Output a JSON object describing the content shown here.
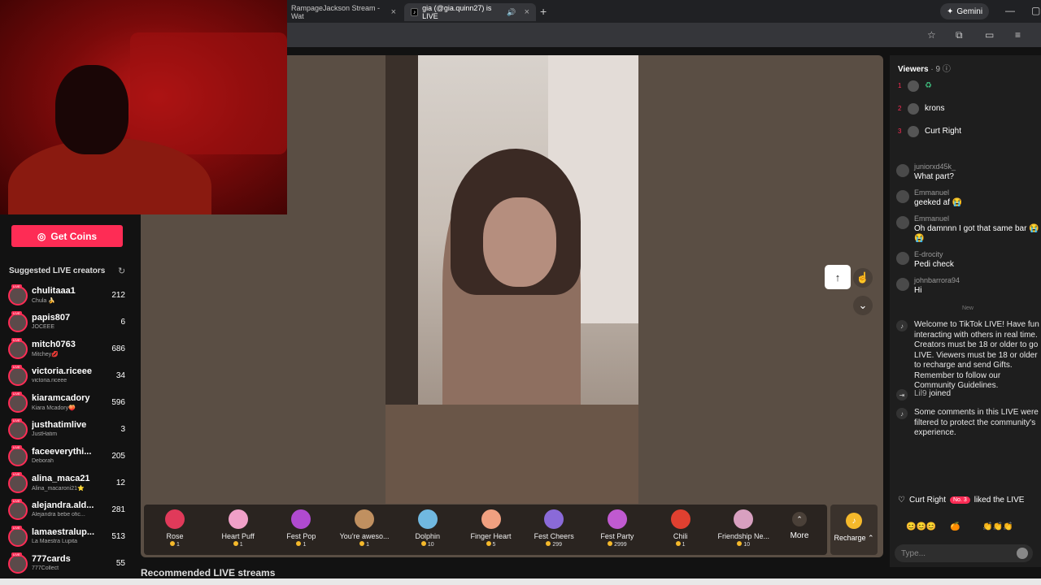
{
  "browser": {
    "tabs": [
      {
        "title": "RampageJackson Stream - Wat"
      },
      {
        "title": "gia (@gia.quinn27) is LIVE"
      }
    ],
    "gemini_label": "Gemini"
  },
  "sidebar": {
    "get_coins_label": "Get Coins",
    "suggested_title": "Suggested LIVE creators",
    "creators": [
      {
        "name": "chulitaaa1",
        "sub": "Chula 🍌",
        "count": "212"
      },
      {
        "name": "papis807",
        "sub": "JOCEEE",
        "count": "6"
      },
      {
        "name": "mitch0763",
        "sub": "Mitchey💋",
        "count": "686"
      },
      {
        "name": "victoria.riceee",
        "sub": "victoria.riceee",
        "count": "34"
      },
      {
        "name": "kiaramcadory",
        "sub": "Kiara Mcadory🍑",
        "count": "596"
      },
      {
        "name": "justhatimlive",
        "sub": "JustHatim",
        "count": "3"
      },
      {
        "name": "faceeverythi...",
        "sub": "Deborah",
        "count": "205"
      },
      {
        "name": "alina_maca21",
        "sub": "Alina_macaroni21⭐",
        "count": "12"
      },
      {
        "name": "alejandra.ald...",
        "sub": "Alejandra bebe ofic...",
        "count": "281"
      },
      {
        "name": "lamaestralup...",
        "sub": "La Maestra Lupita",
        "count": "513"
      },
      {
        "name": "777cards",
        "sub": "777Collect",
        "count": "55"
      }
    ]
  },
  "gifts": [
    {
      "name": "Rose",
      "price": "1",
      "color": "#e03a5a"
    },
    {
      "name": "Heart Puff",
      "price": "1",
      "color": "#f0a0c8"
    },
    {
      "name": "Fest Pop",
      "price": "1",
      "color": "#b04ad0"
    },
    {
      "name": "You're aweso...",
      "price": "1",
      "color": "#c09060"
    },
    {
      "name": "Dolphin",
      "price": "10",
      "color": "#70b8e0"
    },
    {
      "name": "Finger Heart",
      "price": "5",
      "color": "#f0a080"
    },
    {
      "name": "Fest Cheers",
      "price": "299",
      "color": "#8a6ad8"
    },
    {
      "name": "Fest Party",
      "price": "2999",
      "color": "#c05ad0"
    },
    {
      "name": "Chili",
      "price": "1",
      "color": "#e04030"
    },
    {
      "name": "Friendship Ne...",
      "price": "10",
      "color": "#d8a0c0"
    }
  ],
  "more_label": "More",
  "recharge_label": "Recharge ⌃",
  "recommended_title": "Recommended LIVE streams",
  "chat": {
    "viewers_label": "Viewers",
    "viewers_count": "· 9",
    "top_viewers": [
      {
        "rank": "1",
        "name": "♻"
      },
      {
        "rank": "2",
        "name": "krons"
      },
      {
        "rank": "3",
        "name": "Curt Right"
      }
    ],
    "messages": [
      {
        "user": "juniorxd45k_",
        "text": "What part?"
      },
      {
        "user": "Emmanuel",
        "text": "geeked af 😭"
      },
      {
        "user": "Emmanuel",
        "text": "Oh damnnn I got that same bar 😭😭"
      },
      {
        "user": "E-drocity",
        "text": "Pedi check"
      },
      {
        "user": "johnbarrora94",
        "text": "Hi"
      }
    ],
    "new_label": "New",
    "system_welcome": "Welcome to TikTok LIVE! Have fun interacting with others in real time. Creators must be 18 or older to go LIVE. Viewers must be 18 or older to recharge and send Gifts. Remember to follow our Community Guidelines.",
    "joined_user": "Lil9",
    "joined_label": "joined",
    "filter_notice": "Some comments in this LIVE were filtered to protect the community's experience.",
    "liked_user": "Curt Right",
    "liked_badge": "No. 3",
    "liked_label": "liked the LIVE",
    "input_placeholder": "Type..."
  }
}
